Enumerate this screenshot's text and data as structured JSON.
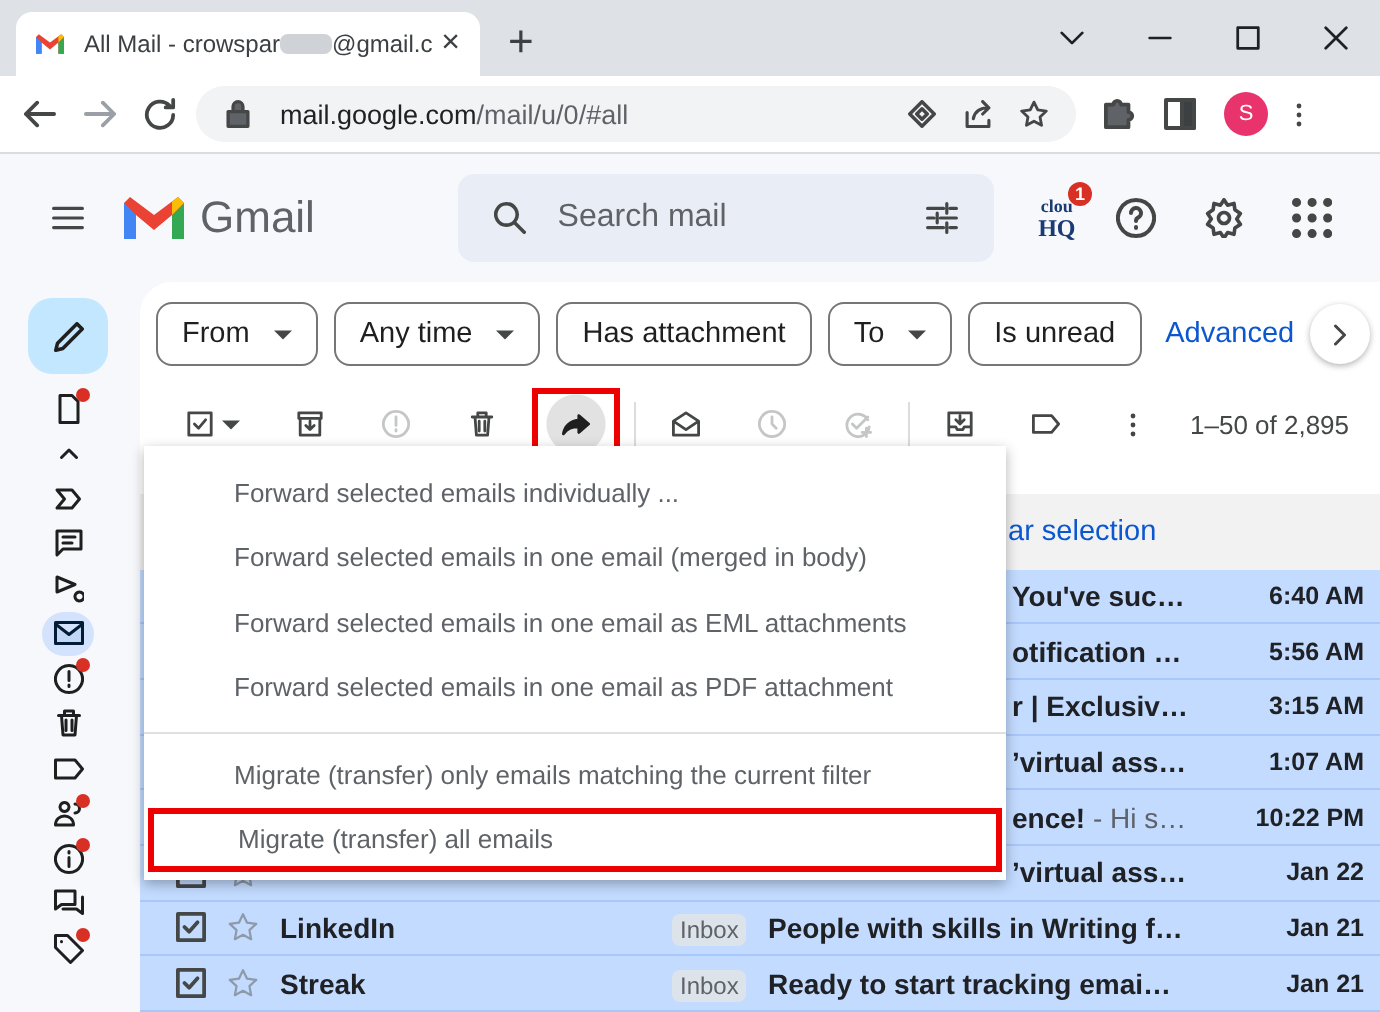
{
  "browser": {
    "tab": {
      "title_start": "All Mail - crowspar",
      "title_end": "@gmail.c",
      "close": "×"
    },
    "new_tab": "+",
    "url_host": "mail.google.com",
    "url_path": "/mail/u/0/#all",
    "avatar": "S"
  },
  "header": {
    "app_name": "Gmail",
    "search": {
      "placeholder": "Search mail"
    },
    "addon": {
      "top": "clou",
      "bottom": "HQ",
      "badge": "1"
    }
  },
  "rail": [
    {
      "kind": "drafts",
      "selected": false,
      "badge": true
    },
    {
      "kind": "less",
      "selected": false,
      "badge": false
    },
    {
      "kind": "important",
      "selected": false,
      "badge": false
    },
    {
      "kind": "chats",
      "selected": false,
      "badge": false
    },
    {
      "kind": "scheduled",
      "selected": false,
      "badge": false
    },
    {
      "kind": "allmail",
      "selected": true,
      "badge": false
    },
    {
      "kind": "spam",
      "selected": false,
      "badge": true
    },
    {
      "kind": "trash",
      "selected": false,
      "badge": false
    },
    {
      "kind": "label",
      "selected": false,
      "badge": false
    },
    {
      "kind": "social",
      "selected": false,
      "badge": true
    },
    {
      "kind": "updates",
      "selected": false,
      "badge": true
    },
    {
      "kind": "forums",
      "selected": false,
      "badge": false
    },
    {
      "kind": "promotions",
      "selected": false,
      "badge": true
    }
  ],
  "filters": [
    {
      "label": "From",
      "dropdown": true
    },
    {
      "label": "Any time",
      "dropdown": true
    },
    {
      "label": "Has attachment",
      "dropdown": false
    },
    {
      "label": "To",
      "dropdown": true
    },
    {
      "label": "Is unread",
      "dropdown": false
    }
  ],
  "advanced_link": "Advanced",
  "toolbar": [
    {
      "kind": "select",
      "disabled": false,
      "highlighted": false,
      "divider_before": false
    },
    {
      "kind": "archive",
      "disabled": false,
      "highlighted": false,
      "divider_before": false
    },
    {
      "kind": "spam",
      "disabled": true,
      "highlighted": false,
      "divider_before": false
    },
    {
      "kind": "delete",
      "disabled": false,
      "highlighted": false,
      "divider_before": false
    },
    {
      "kind": "forward",
      "disabled": false,
      "highlighted": true,
      "divider_before": false
    },
    {
      "kind": "read",
      "disabled": false,
      "highlighted": false,
      "divider_before": true
    },
    {
      "kind": "snooze",
      "disabled": true,
      "highlighted": false,
      "divider_before": false
    },
    {
      "kind": "task",
      "disabled": true,
      "highlighted": false,
      "divider_before": false
    },
    {
      "kind": "inbox",
      "disabled": false,
      "highlighted": false,
      "divider_before": true
    },
    {
      "kind": "label",
      "disabled": false,
      "highlighted": false,
      "divider_before": false
    },
    {
      "kind": "more",
      "disabled": false,
      "highlighted": false,
      "divider_before": false
    }
  ],
  "page_count": "1–50 of 2,895",
  "selection_bar": "ar selection",
  "rows": [
    {
      "kind": "covered",
      "selected": true,
      "sender": "",
      "label": "",
      "subject": "You've suc…",
      "snippet": "",
      "time": "6:40 AM"
    },
    {
      "kind": "covered",
      "selected": true,
      "sender": "",
      "label": "",
      "subject": "otification …",
      "snippet": "",
      "time": "5:56 AM"
    },
    {
      "kind": "covered",
      "selected": true,
      "sender": "",
      "label": "",
      "subject": "r | Exclusiv…",
      "snippet": "",
      "time": "3:15 AM"
    },
    {
      "kind": "covered",
      "selected": true,
      "sender": "",
      "label": "",
      "subject": "’virtual ass…",
      "snippet": "",
      "time": "1:07 AM"
    },
    {
      "kind": "covered",
      "selected": true,
      "sender": "",
      "label": "",
      "subject": "ence!",
      "snippet": " - Hi s…",
      "time": "10:22 PM"
    },
    {
      "kind": "covered",
      "selected": true,
      "sender": "",
      "label": "",
      "subject": "’virtual ass…",
      "snippet": "",
      "time": "Jan 22"
    },
    {
      "kind": "full",
      "selected": true,
      "sender": "LinkedIn",
      "label": "Inbox",
      "subject": "People with skills in Writing f…",
      "snippet": "",
      "time": "Jan 21"
    },
    {
      "kind": "full",
      "selected": true,
      "sender": "Streak",
      "label": "Inbox",
      "subject": "Ready to start tracking emai…",
      "snippet": "",
      "time": "Jan 21"
    }
  ],
  "forward_menu": [
    {
      "label": "Forward selected emails individually ...",
      "highlighted": false,
      "divider_before": false
    },
    {
      "label": "Forward selected emails in one email (merged in body)",
      "highlighted": false,
      "divider_before": false
    },
    {
      "label": "Forward selected emails in one email as EML attachments",
      "highlighted": false,
      "divider_before": false
    },
    {
      "label": "Forward selected emails in one email as PDF attachment",
      "highlighted": false,
      "divider_before": false
    },
    {
      "label": "Migrate (transfer) only emails matching the current filter",
      "highlighted": false,
      "divider_before": true
    },
    {
      "label": "Migrate (transfer) all emails",
      "highlighted": true,
      "divider_before": false
    }
  ]
}
